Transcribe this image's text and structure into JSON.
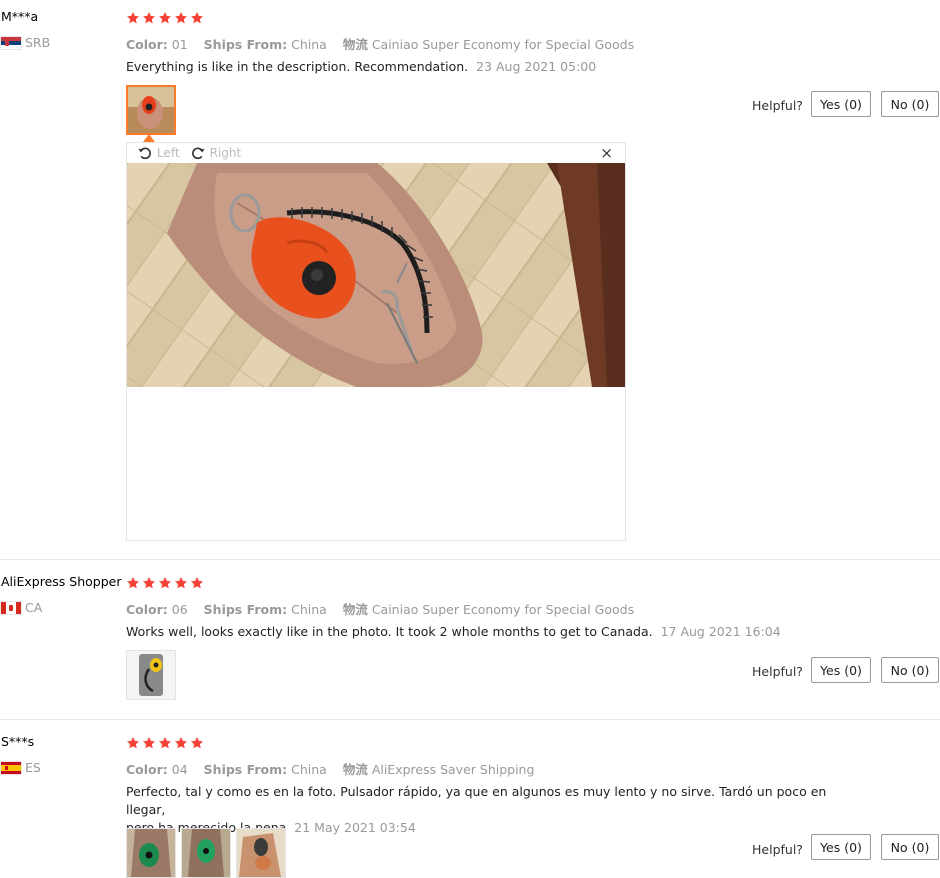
{
  "labels": {
    "color": "Color:",
    "ships_from": "Ships From:",
    "shipping_prefix": "物流",
    "helpful": "Helpful?"
  },
  "colors": {
    "star": "#f44336",
    "meta_gray": "#999999",
    "active_thumb_border": "#ff7a2b"
  },
  "icons": {
    "star": "star-icon",
    "rotate_left": "rotate-left-icon",
    "rotate_right": "rotate-right-icon",
    "close": "close-icon"
  },
  "reviews": [
    {
      "user": "M***a",
      "country": "SRB",
      "rating": 5,
      "color": "01",
      "ships_from": "China",
      "shipping": "Cainiao Super Economy for Special Goods",
      "text": "Everything is like in the description. Recommendation.",
      "date": "23 Aug 2021 05:00",
      "yes": "Yes (0)",
      "no": "No (0)",
      "photo_count": 1
    },
    {
      "user": "AliExpress Shopper",
      "country": "CA",
      "rating": 5,
      "color": "06",
      "ships_from": "China",
      "shipping": "Cainiao Super Economy for Special Goods",
      "text": "Works well, looks exactly like in the photo. It took 2 whole months to get to Canada.",
      "date": "17 Aug 2021 16:04",
      "yes": "Yes (0)",
      "no": "No (0)",
      "photo_count": 1
    },
    {
      "user": "S***s",
      "country": "ES",
      "rating": 5,
      "color": "04",
      "ships_from": "China",
      "shipping": "AliExpress Saver Shipping",
      "text_line1": "Perfecto, tal y como es en la foto. Pulsador rápido, ya que en algunos es muy lento y no sirve. Tardó un poco en llegar,",
      "text_line2": "pero ha merecido la pena",
      "date": "21 May 2021 03:54",
      "yes": "Yes (0)",
      "no": "No (0)",
      "photo_count": 3
    }
  ],
  "viewer": {
    "rotate_left_label": "Left",
    "rotate_right_label": "Right",
    "close_label": "×"
  }
}
